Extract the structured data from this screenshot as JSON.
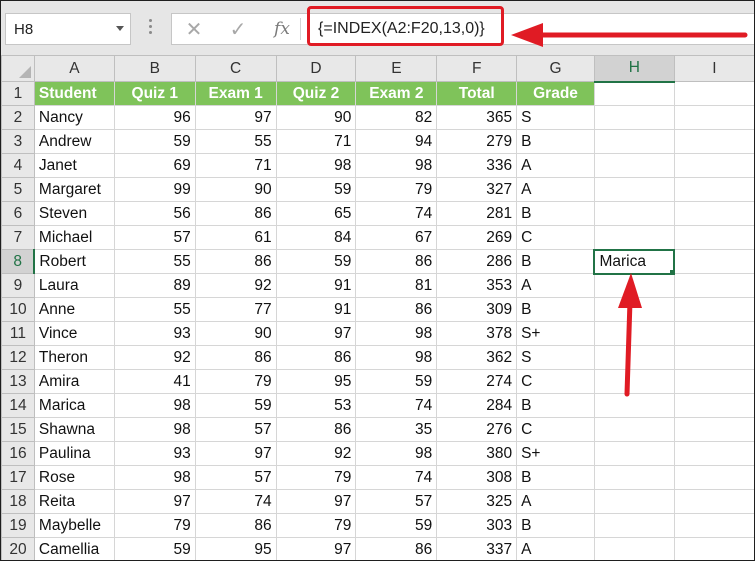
{
  "name_box": "H8",
  "formula": "{=INDEX(A2:F20,13,0)}",
  "icons": {
    "cancel": "close-icon",
    "enter": "check-icon",
    "function": "fx-icon"
  },
  "fx_label": "fx",
  "cancel_glyph": "✕",
  "enter_glyph": "✓",
  "columns": [
    "A",
    "B",
    "C",
    "D",
    "E",
    "F",
    "G",
    "H",
    "I"
  ],
  "header_row": [
    "Student",
    "Quiz 1",
    "Exam 1",
    "Quiz 2",
    "Exam 2",
    "Total",
    "Grade"
  ],
  "rows": [
    [
      "Nancy",
      "96",
      "97",
      "90",
      "82",
      "365",
      "S"
    ],
    [
      "Andrew",
      "59",
      "55",
      "71",
      "94",
      "279",
      "B"
    ],
    [
      "Janet",
      "69",
      "71",
      "98",
      "98",
      "336",
      "A"
    ],
    [
      "Margaret",
      "99",
      "90",
      "59",
      "79",
      "327",
      "A"
    ],
    [
      "Steven",
      "56",
      "86",
      "65",
      "74",
      "281",
      "B"
    ],
    [
      "Michael",
      "57",
      "61",
      "84",
      "67",
      "269",
      "C"
    ],
    [
      "Robert",
      "55",
      "86",
      "59",
      "86",
      "286",
      "B"
    ],
    [
      "Laura",
      "89",
      "92",
      "91",
      "81",
      "353",
      "A"
    ],
    [
      "Anne",
      "55",
      "77",
      "91",
      "86",
      "309",
      "B"
    ],
    [
      "Vince",
      "93",
      "90",
      "97",
      "98",
      "378",
      "S+"
    ],
    [
      "Theron",
      "92",
      "86",
      "86",
      "98",
      "362",
      "S"
    ],
    [
      "Amira",
      "41",
      "79",
      "95",
      "59",
      "274",
      "C"
    ],
    [
      "Marica",
      "98",
      "59",
      "53",
      "74",
      "284",
      "B"
    ],
    [
      "Shawna",
      "98",
      "57",
      "86",
      "35",
      "276",
      "C"
    ],
    [
      "Paulina",
      "93",
      "97",
      "92",
      "98",
      "380",
      "S+"
    ],
    [
      "Rose",
      "98",
      "57",
      "79",
      "74",
      "308",
      "B"
    ],
    [
      "Reita",
      "97",
      "74",
      "97",
      "57",
      "325",
      "A"
    ],
    [
      "Maybelle",
      "79",
      "86",
      "79",
      "59",
      "303",
      "B"
    ],
    [
      "Camellia",
      "59",
      "95",
      "97",
      "86",
      "337",
      "A"
    ]
  ],
  "active_cell_value": "Marica",
  "colors": {
    "header_fill": "#7fc35a",
    "accent": "#217346",
    "annotation": "#e01b24"
  }
}
